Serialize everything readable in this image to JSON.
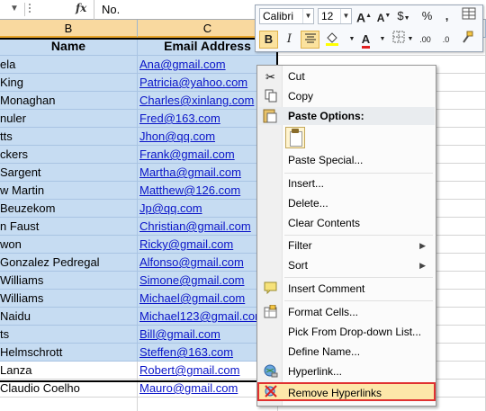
{
  "formula_bar": {
    "content": "No."
  },
  "columns": {
    "b": "B",
    "c": "C"
  },
  "header_row": {
    "name": "Name",
    "email": "Email Address"
  },
  "rows": [
    {
      "name": "ela",
      "email": "Ana@gmail.com"
    },
    {
      "name": "King",
      "email": "Patricia@yahoo.com"
    },
    {
      "name": "Monaghan",
      "email": "Charles@xinlang.com"
    },
    {
      "name": "nuler",
      "email": "Fred@163.com"
    },
    {
      "name": "tts",
      "email": "Jhon@qq.com"
    },
    {
      "name": "ckers",
      "email": "Frank@gmail.com"
    },
    {
      "name": "Sargent",
      "email": "Martha@gmail.com"
    },
    {
      "name": "w Martin",
      "email": "Matthew@126.com"
    },
    {
      "name": "Beuzekom",
      "email": "Jp@qq.com"
    },
    {
      "name": "n Faust",
      "email": "Christian@gmail.com"
    },
    {
      "name": "won",
      "email": "Ricky@gmail.com"
    },
    {
      "name": "Gonzalez Pedregal",
      "email": "Alfonso@gmail.com"
    },
    {
      "name": "Williams",
      "email": "Simone@gmail.com"
    },
    {
      "name": "Williams",
      "email": "Michael@gmail.com"
    },
    {
      "name": "Naidu",
      "email": "Michael123@gmail.com"
    },
    {
      "name": "ts",
      "email": "Bill@gmail.com"
    },
    {
      "name": "Helmschrott",
      "email": "Steffen@163.com"
    }
  ],
  "rows_unselected": [
    {
      "name": "Lanza",
      "email": "Robert@gmail.com"
    },
    {
      "name": "Claudio Coelho",
      "email": "Mauro@gmail.com"
    },
    {
      "name": "",
      "email": ""
    }
  ],
  "mini_toolbar": {
    "font": "Calibri",
    "size": "12",
    "grow": "A",
    "shrink": "A",
    "currency": "$",
    "percent": "%",
    "comma": ",",
    "bold": "B",
    "italic": "I",
    "font_color": "A"
  },
  "context_menu": {
    "cut": "Cut",
    "copy": "Copy",
    "paste_options": "Paste Options:",
    "paste_special": "Paste Special...",
    "insert": "Insert...",
    "delete": "Delete...",
    "clear_contents": "Clear Contents",
    "filter": "Filter",
    "sort": "Sort",
    "insert_comment": "Insert Comment",
    "format_cells": "Format Cells...",
    "pick_list": "Pick From Drop-down List...",
    "define_name": "Define Name...",
    "hyperlink": "Hyperlink...",
    "remove_hyperlinks": "Remove Hyperlinks"
  },
  "colors": {
    "selection": "#c6dcf2",
    "selected_header": "#f9d99f",
    "hyperlink": "#0a14c8",
    "highlight_border": "#e03131",
    "menu_hover": "#fde7a9"
  }
}
